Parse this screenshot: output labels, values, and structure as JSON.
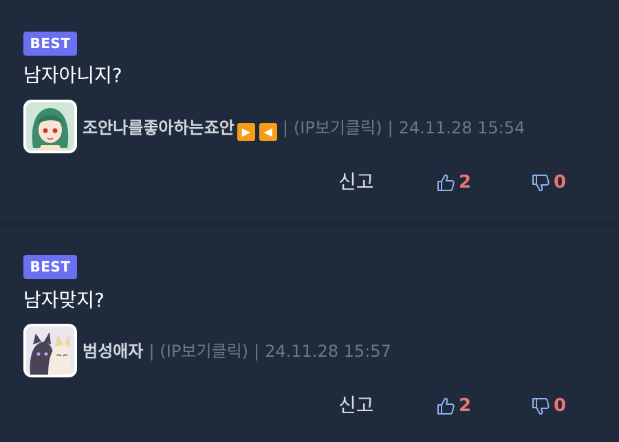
{
  "theme": {
    "background": "#1f2b3c",
    "badge_color": "#6b6ff2",
    "count_color": "#e97575",
    "icon_color": "#8fb3ec"
  },
  "comments": [
    {
      "badge": "BEST",
      "text": "남자아니지?",
      "author": "조안나를좋아하는죠안",
      "author_emoji": [
        "▶",
        "◀"
      ],
      "ip_label": "(IP보기클릭)",
      "separator": "|",
      "timestamp": "24.11.28 15:54",
      "avatar_icon": "green-hair-character-avatar",
      "report_label": "신고",
      "upvotes": "2",
      "downvotes": "0"
    },
    {
      "badge": "BEST",
      "text": "남자맞지?",
      "author": "범성애자",
      "author_emoji": [],
      "ip_label": "(IP보기클릭)",
      "separator": "|",
      "timestamp": "24.11.28 15:57",
      "avatar_icon": "cat-characters-avatar",
      "report_label": "신고",
      "upvotes": "2",
      "downvotes": "0"
    }
  ]
}
